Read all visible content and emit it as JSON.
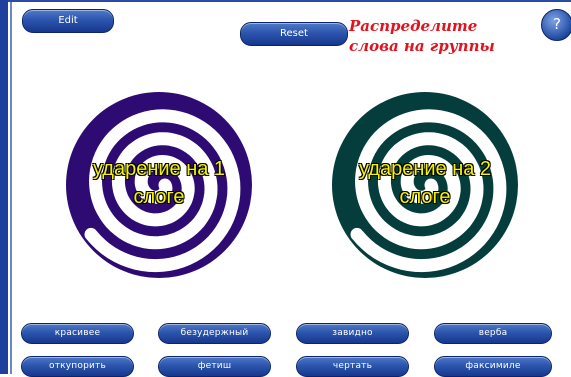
{
  "toolbar": {
    "edit_label": "Edit",
    "reset_label": "Reset",
    "help_label": "?"
  },
  "title": {
    "line1": "Распределите",
    "line2": "слова на группы"
  },
  "groups": [
    {
      "line1": "ударение на 1",
      "line2": "слоге",
      "color": "#2e0b73"
    },
    {
      "line1": "ударение на 2",
      "line2": "слоге",
      "color": "#043d3b"
    }
  ],
  "words": {
    "row1": [
      "красивее",
      "безудержный",
      "завидно",
      "верба"
    ],
    "row2": [
      "откупорить",
      "фетиш",
      "чертать",
      "факсимиле"
    ]
  },
  "colors": {
    "accent_button": "#2c55ad",
    "frame": "#1f3f9f",
    "title_red": "#e0131e",
    "label_yellow": "#f4f201"
  }
}
